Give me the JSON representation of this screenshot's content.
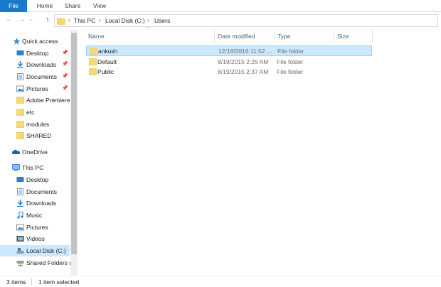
{
  "ribbon": {
    "tabs": [
      "File",
      "Home",
      "Share",
      "View"
    ]
  },
  "address": {
    "crumbs": [
      "This PC",
      "Local Disk (C:)",
      "Users"
    ]
  },
  "nav": {
    "quick_access": "Quick access",
    "items": [
      {
        "label": "Quick access",
        "icon": "star-icon"
      },
      {
        "label": "Desktop",
        "icon": "desktop-icon",
        "pinned": true
      },
      {
        "label": "Downloads",
        "icon": "download-icon",
        "pinned": true
      },
      {
        "label": "Documents",
        "icon": "documents-icon",
        "pinned": true
      },
      {
        "label": "Pictures",
        "icon": "pictures-icon",
        "pinned": true
      },
      {
        "label": "Adobe Premiere",
        "icon": "folder-icon"
      },
      {
        "label": "etc",
        "icon": "folder-icon"
      },
      {
        "label": "modules",
        "icon": "folder-icon"
      },
      {
        "label": "SHARED",
        "icon": "folder-icon"
      },
      {
        "label": "OneDrive",
        "icon": "onedrive-icon"
      },
      {
        "label": "This PC",
        "icon": "pc-icon"
      },
      {
        "label": "Desktop",
        "icon": "desktop-icon"
      },
      {
        "label": "Documents",
        "icon": "documents-icon"
      },
      {
        "label": "Downloads",
        "icon": "download-icon"
      },
      {
        "label": "Music",
        "icon": "music-icon"
      },
      {
        "label": "Pictures",
        "icon": "pictures-icon"
      },
      {
        "label": "Videos",
        "icon": "videos-icon"
      },
      {
        "label": "Local Disk (C:)",
        "icon": "drive-icon",
        "selected": true
      },
      {
        "label": "Shared Folders (\\",
        "icon": "network-drive-icon"
      }
    ]
  },
  "columns": {
    "name": "Name",
    "date": "Date modified",
    "type": "Type",
    "size": "Size"
  },
  "files": [
    {
      "name": "ankush",
      "date": "12/18/2016 11:52 ...",
      "type": "File folder",
      "size": "",
      "selected": true
    },
    {
      "name": "Default",
      "date": "8/19/2015 2:25 AM",
      "type": "File folder",
      "size": ""
    },
    {
      "name": "Public",
      "date": "8/19/2015 2:37 AM",
      "type": "File folder",
      "size": ""
    }
  ],
  "status": {
    "count": "3 items",
    "selected": "1 item selected"
  },
  "colors": {
    "accent": "#1979ca",
    "selection": "#cce8ff",
    "folder": "#f8d775"
  }
}
